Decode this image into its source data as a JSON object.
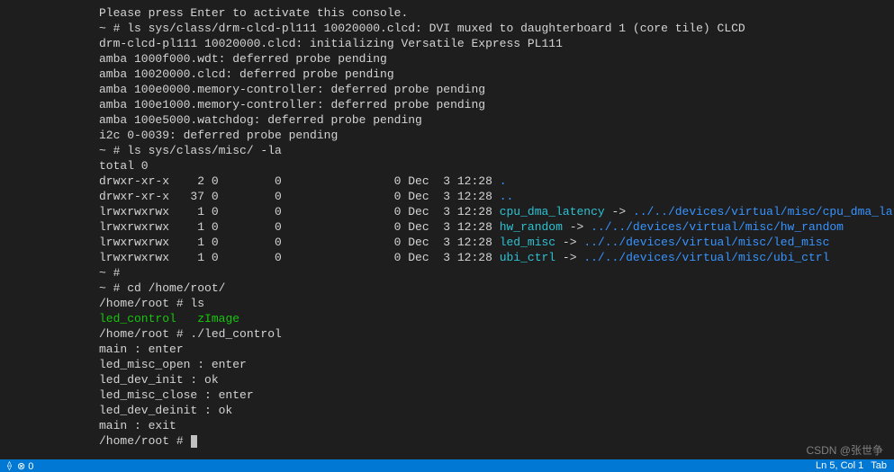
{
  "terminal": {
    "lines": [
      {
        "segments": [
          {
            "s": "c-white",
            "t": "Please press Enter to activate this console."
          }
        ]
      },
      {
        "segments": [
          {
            "s": "c-white",
            "t": "~ # ls sys/class/drm-clcd-pl111 10020000.clcd: DVI muxed to daughterboard 1 (core tile) CLCD"
          }
        ]
      },
      {
        "segments": [
          {
            "s": "c-white",
            "t": "drm-clcd-pl111 10020000.clcd: initializing Versatile Express PL111"
          }
        ]
      },
      {
        "segments": [
          {
            "s": "c-white",
            "t": "amba 1000f000.wdt: deferred probe pending"
          }
        ]
      },
      {
        "segments": [
          {
            "s": "c-white",
            "t": "amba 10020000.clcd: deferred probe pending"
          }
        ]
      },
      {
        "segments": [
          {
            "s": "c-white",
            "t": "amba 100e0000.memory-controller: deferred probe pending"
          }
        ]
      },
      {
        "segments": [
          {
            "s": "c-white",
            "t": "amba 100e1000.memory-controller: deferred probe pending"
          }
        ]
      },
      {
        "segments": [
          {
            "s": "c-white",
            "t": "amba 100e5000.watchdog: deferred probe pending"
          }
        ]
      },
      {
        "segments": [
          {
            "s": "c-white",
            "t": "i2c 0-0039: deferred probe pending"
          }
        ]
      },
      {
        "segments": [
          {
            "s": "c-white",
            "t": "~ # ls sys/class/misc/ -la"
          }
        ]
      },
      {
        "segments": [
          {
            "s": "c-white",
            "t": "total 0"
          }
        ]
      },
      {
        "segments": [
          {
            "s": "c-white",
            "t": "drwxr-xr-x    2 0        0                0 Dec  3 12:28 "
          },
          {
            "s": "c-blue",
            "t": "."
          }
        ]
      },
      {
        "segments": [
          {
            "s": "c-white",
            "t": "drwxr-xr-x   37 0        0                0 Dec  3 12:28 "
          },
          {
            "s": "c-blue",
            "t": ".."
          }
        ]
      },
      {
        "segments": [
          {
            "s": "c-white",
            "t": "lrwxrwxrwx    1 0        0                0 Dec  3 12:28 "
          },
          {
            "s": "c-cyan",
            "t": "cpu_dma_latency"
          },
          {
            "s": "c-white",
            "t": " -> "
          },
          {
            "s": "c-blue",
            "t": "../../devices/virtual/misc/cpu_dma_latency"
          }
        ]
      },
      {
        "segments": [
          {
            "s": "c-white",
            "t": "lrwxrwxrwx    1 0        0                0 Dec  3 12:28 "
          },
          {
            "s": "c-cyan",
            "t": "hw_random"
          },
          {
            "s": "c-white",
            "t": " -> "
          },
          {
            "s": "c-blue",
            "t": "../../devices/virtual/misc/hw_random"
          }
        ]
      },
      {
        "segments": [
          {
            "s": "c-white",
            "t": "lrwxrwxrwx    1 0        0                0 Dec  3 12:28 "
          },
          {
            "s": "c-cyan",
            "t": "led_misc"
          },
          {
            "s": "c-white",
            "t": " -> "
          },
          {
            "s": "c-blue",
            "t": "../../devices/virtual/misc/led_misc"
          }
        ]
      },
      {
        "segments": [
          {
            "s": "c-white",
            "t": "lrwxrwxrwx    1 0        0                0 Dec  3 12:28 "
          },
          {
            "s": "c-cyan",
            "t": "ubi_ctrl"
          },
          {
            "s": "c-white",
            "t": " -> "
          },
          {
            "s": "c-blue",
            "t": "../../devices/virtual/misc/ubi_ctrl"
          }
        ]
      },
      {
        "segments": [
          {
            "s": "c-white",
            "t": "~ #"
          }
        ]
      },
      {
        "segments": [
          {
            "s": "c-white",
            "t": "~ # cd /home/root/"
          }
        ]
      },
      {
        "segments": [
          {
            "s": "c-white",
            "t": "/home/root # ls"
          }
        ]
      },
      {
        "segments": [
          {
            "s": "c-green",
            "t": "led_control"
          },
          {
            "s": "c-white",
            "t": "   "
          },
          {
            "s": "c-green",
            "t": "zImage"
          }
        ]
      },
      {
        "segments": [
          {
            "s": "c-white",
            "t": "/home/root # ./led_control"
          }
        ]
      },
      {
        "segments": [
          {
            "s": "c-white",
            "t": "main : enter"
          }
        ]
      },
      {
        "segments": [
          {
            "s": "c-white",
            "t": "led_misc_open : enter"
          }
        ]
      },
      {
        "segments": [
          {
            "s": "c-white",
            "t": "led_dev_init : ok"
          }
        ]
      },
      {
        "segments": [
          {
            "s": "c-white",
            "t": "led_misc_close : enter"
          }
        ]
      },
      {
        "segments": [
          {
            "s": "c-white",
            "t": "led_dev_deinit : ok"
          }
        ]
      },
      {
        "segments": [
          {
            "s": "c-white",
            "t": "main : exit"
          }
        ]
      },
      {
        "segments": [
          {
            "s": "c-white",
            "t": "/home/root # "
          }
        ],
        "cursor": true
      }
    ]
  },
  "statusbar": {
    "left_count": "0",
    "position": "Ln 5, Col 1",
    "spaces": "Tab"
  },
  "watermark": "CSDN @张世争"
}
